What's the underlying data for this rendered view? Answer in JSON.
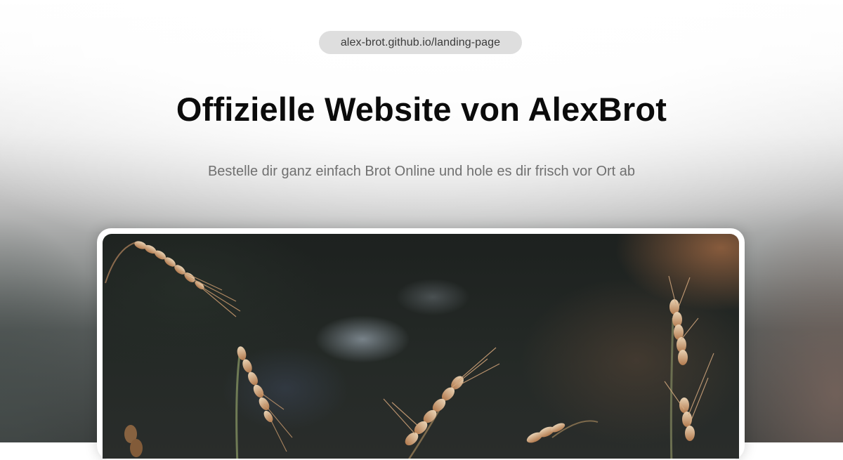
{
  "header": {
    "url": "alex-brot.github.io/landing-page",
    "title": "Offizielle Website von AlexBrot",
    "subtitle": "Bestelle dir ganz einfach Brot Online und hole es dir frisch vor Ort ab"
  },
  "hero": {
    "image_subject": "wheat-ears-photo"
  },
  "colors": {
    "title": "#0b0b0b",
    "subtitle": "#707070",
    "pill_background": "#dedede",
    "frame": "#ffffff"
  }
}
